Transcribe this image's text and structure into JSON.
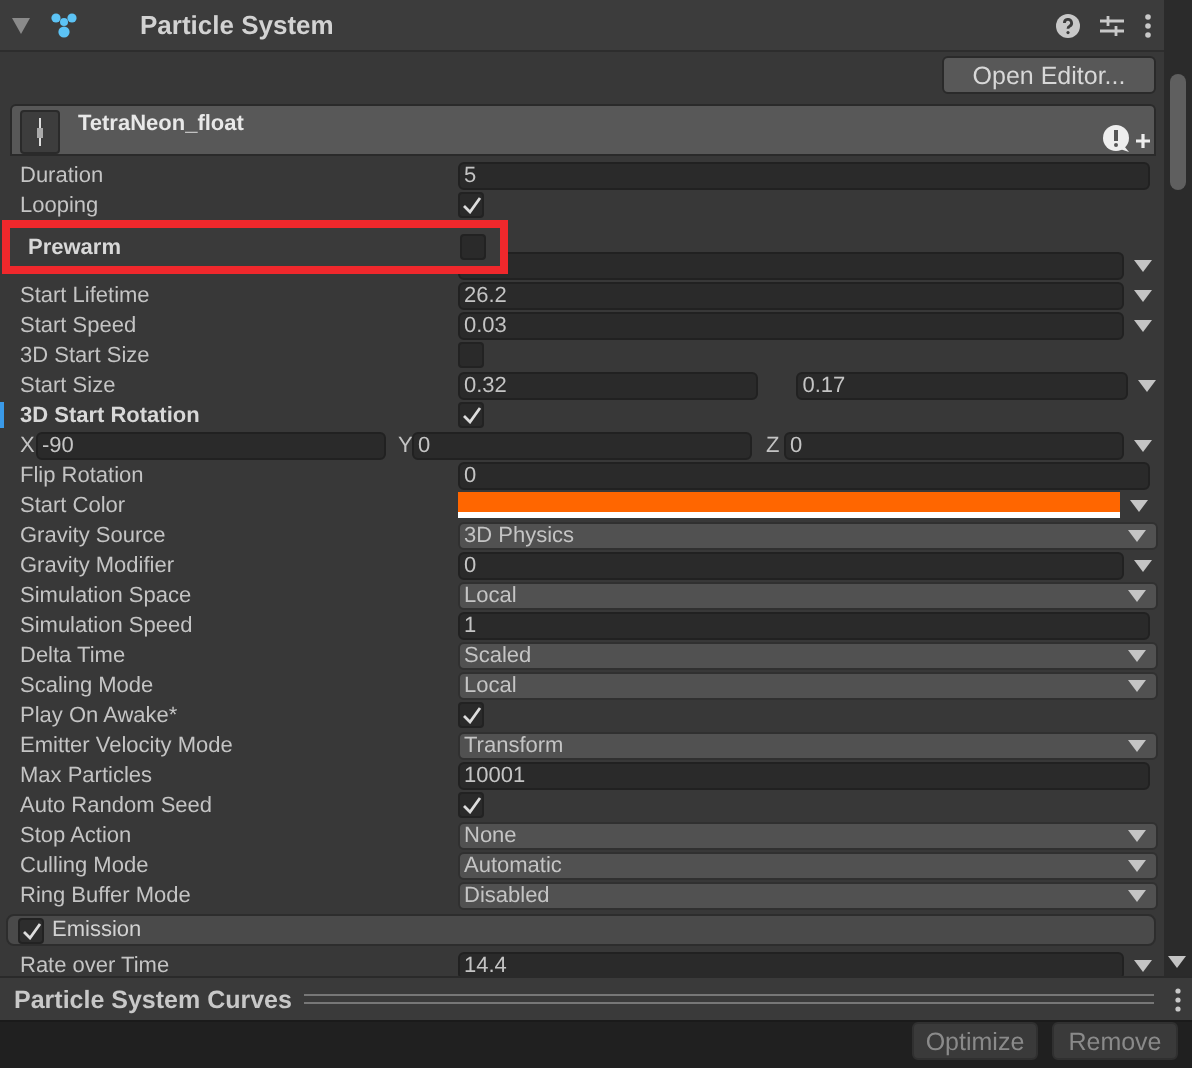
{
  "component": {
    "title": "Particle System",
    "expanded": true
  },
  "open_editor_button": "Open Editor...",
  "module": {
    "name": "TetraNeon_float"
  },
  "rows": [
    {
      "kind": "field",
      "label": "Duration",
      "value": "5"
    },
    {
      "kind": "checkbox",
      "label": "Looping",
      "checked": true
    },
    {
      "kind": "checkbox",
      "label": "Prewarm",
      "checked": false,
      "highlighted": true
    },
    {
      "kind": "minmax"
    },
    {
      "kind": "minmax",
      "label": "Start Lifetime",
      "value": "26.2"
    },
    {
      "kind": "minmax",
      "label": "Start Speed",
      "value": "0.03"
    },
    {
      "kind": "checkbox",
      "label": "3D Start Size",
      "checked": false
    },
    {
      "kind": "pair",
      "label": "Start Size",
      "values": [
        "0.32",
        "0.17"
      ]
    },
    {
      "kind": "checkbox",
      "label": "3D Start Rotation",
      "checked": true,
      "modified": true
    },
    {
      "kind": "xyz",
      "axes": [
        {
          "axis": "X",
          "value": "-90"
        },
        {
          "axis": "Y",
          "value": "0"
        },
        {
          "axis": "Z",
          "value": "0"
        }
      ]
    },
    {
      "kind": "field",
      "label": "Flip Rotation",
      "value": "0"
    },
    {
      "kind": "color",
      "label": "Start Color",
      "color": "#ff6600"
    },
    {
      "kind": "popup",
      "label": "Gravity Source",
      "value": "3D Physics"
    },
    {
      "kind": "minmax",
      "label": "Gravity Modifier",
      "value": "0"
    },
    {
      "kind": "popup",
      "label": "Simulation Space",
      "value": "Local"
    },
    {
      "kind": "field",
      "label": "Simulation Speed",
      "value": "1"
    },
    {
      "kind": "popup",
      "label": "Delta Time",
      "value": "Scaled"
    },
    {
      "kind": "popup",
      "label": "Scaling Mode",
      "value": "Local"
    },
    {
      "kind": "checkbox",
      "label": "Play On Awake*",
      "checked": true
    },
    {
      "kind": "popup",
      "label": "Emitter Velocity Mode",
      "value": "Transform"
    },
    {
      "kind": "field",
      "label": "Max Particles",
      "value": "10001"
    },
    {
      "kind": "checkbox",
      "label": "Auto Random Seed",
      "checked": true
    },
    {
      "kind": "popup",
      "label": "Stop Action",
      "value": "None"
    },
    {
      "kind": "popup",
      "label": "Culling Mode",
      "value": "Automatic"
    },
    {
      "kind": "popup",
      "label": "Ring Buffer Mode",
      "value": "Disabled"
    }
  ],
  "emission": {
    "label": "Emission",
    "checked": true,
    "rows": [
      {
        "kind": "minmax",
        "label": "Rate over Time",
        "value": "14.4"
      }
    ]
  },
  "curves": {
    "title": "Particle System Curves"
  },
  "bottom_buttons": [
    {
      "label": "Optimize"
    },
    {
      "label": "Remove"
    }
  ]
}
